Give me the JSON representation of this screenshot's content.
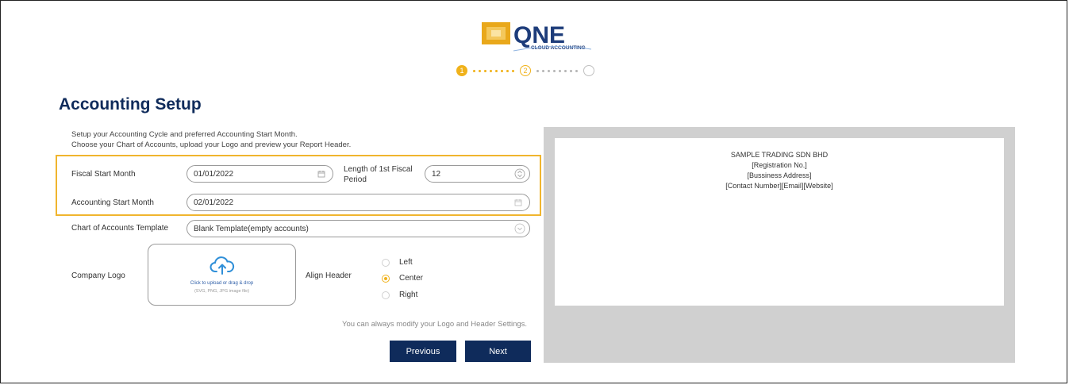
{
  "brand": {
    "name": "QNE",
    "subtitle": "CLOUD ACCOUNTING",
    "accent": "#f0b21b",
    "navy": "#0f2b5b"
  },
  "stepper": {
    "steps": [
      {
        "label": "1",
        "state": "done"
      },
      {
        "label": "2",
        "state": "active"
      },
      {
        "label": "",
        "state": "todo"
      }
    ]
  },
  "page": {
    "title": "Accounting Setup",
    "description_line1": "Setup your Accounting Cycle and preferred Accounting Start Month.",
    "description_line2": "Choose your Chart of Accounts, upload your Logo and preview your Report Header."
  },
  "form": {
    "fiscal_start_month": {
      "label": "Fiscal Start Month",
      "value": "01/01/2022",
      "icon": "calendar-icon"
    },
    "first_fiscal_period": {
      "label_line1": "Length of 1st Fiscal",
      "label_line2": "Period",
      "value": "12",
      "icon": "spinner-icon"
    },
    "accounting_start_month": {
      "label": "Accounting Start Month",
      "value": "02/01/2022",
      "icon": "calendar-icon"
    },
    "chart_of_accounts": {
      "label": "Chart of Accounts Template",
      "value": "Blank Template(empty accounts)",
      "icon": "chevron-down-icon"
    },
    "company_logo": {
      "label": "Company Logo",
      "upload_text": "Click to upload or drag & drop",
      "upload_hint": "(SVG, PNG, JPG image file)",
      "icon": "cloud-upload-icon"
    },
    "align_header": {
      "label": "Align Header",
      "options": [
        {
          "label": "Left",
          "selected": false
        },
        {
          "label": "Center",
          "selected": true
        },
        {
          "label": "Right",
          "selected": false
        }
      ]
    },
    "note": "You can always modify your Logo and Header Settings.",
    "previous_label": "Previous",
    "next_label": "Next"
  },
  "preview": {
    "company_name": "SAMPLE TRADING SDN BHD",
    "registration": "[Registration No.]",
    "address": "[Bussiness Address]",
    "contact": "[Contact Number][Email][Website]"
  }
}
